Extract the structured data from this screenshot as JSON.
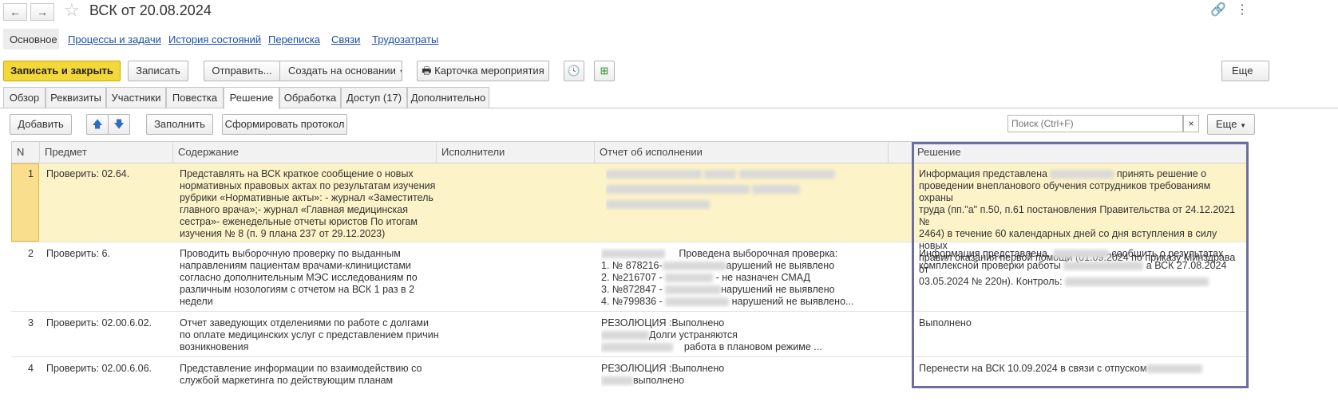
{
  "window": {
    "title": "ВСК от 20.08.2024",
    "more_glyph": "⋮"
  },
  "nav_links": [
    "Основное",
    "Процессы и задачи",
    "История состояний",
    "Переписка",
    "Связи",
    "Трудозатраты"
  ],
  "toolbar": {
    "save_close": "Записать и закрыть",
    "save": "Записать",
    "send": "Отправить...",
    "create_based": "Создать на основании",
    "event_card": "Карточка мероприятия",
    "more": "Еще"
  },
  "tabs": [
    "Обзор",
    "Реквизиты",
    "Участники",
    "Повестка",
    "Решение",
    "Обработка",
    "Доступ (17)",
    "Дополнительно"
  ],
  "grid_toolbar": {
    "add": "Добавить",
    "fill": "Заполнить",
    "protocol": "Сформировать протокол",
    "search_placeholder": "Поиск (Ctrl+F)",
    "more": "Еще"
  },
  "columns": [
    "N",
    "Предмет",
    "Содержание",
    "Исполнители",
    "Отчет об исполнении",
    "Решение"
  ],
  "rows": [
    {
      "n": "1",
      "subject": "Проверить: 02.64.",
      "content": [
        "Представлять на ВСК краткое сообщение о новых",
        "нормативных правовых актах по результатам изучения",
        "рубрики «Нормативные акты»: - журнал «Заместитель",
        "главного врача»;- журнал «Главная медицинская",
        "сестра»- еженедельные отчеты юристов По итогам",
        "изучения № 8 (п. 9 плана 237 от 29.12.2023)"
      ],
      "report": [],
      "decision": [
        "Информация представлена",
        "принять решение о",
        "проведении внепланового обучения сотрудников требованиям охраны",
        "труда (пп.\"а\" п.50, п.61 постановления Правительства от 24.12.2021 №",
        "2464) в течение 60 календарных дней со дня вступления в силу новых",
        "правил оказания первой помощи (01.09.2024 по приказу Минздрава от",
        "03.05.2024 № 220н). Контроль:"
      ]
    },
    {
      "n": "2",
      "subject": "Проверить: 6.",
      "content": [
        "Проводить выборочную проверку по выданным",
        "направлениям пациентам врачами-клиницистами",
        "согласно дополнительным МЭС исследованиям по",
        "различным нозологиям с отчетом на ВСК 1 раз в 2",
        "недели"
      ],
      "report": [
        "Проведена выборочная проверка:",
        "1. № 878216-",
        "арушений не выявлено",
        "2. №216707 -",
        "- не назначен СМАД",
        "3. №872847 -",
        "нарушений не выявлено",
        "4. №799836 -",
        "нарушений не выявлено..."
      ],
      "decision": [
        "Информация представлена.",
        "сообщить о результатах",
        "комплексной проверки работы",
        "а ВСК 27.08.2024"
      ]
    },
    {
      "n": "3",
      "subject": "Проверить: 02.00.6.02.",
      "content": [
        "Отчет заведующих отделениями по работе с долгами",
        "по оплате медицинских услуг с представлением причин",
        "возникновения"
      ],
      "report": [
        "РЕЗОЛЮЦИЯ :Выполнено",
        "Долги устраняются",
        "работа в плановом режиме ..."
      ],
      "decision": [
        "Выполнено"
      ]
    },
    {
      "n": "4",
      "subject": "Проверить: 02.00.6.06.",
      "content": [
        "Представление информации по взаимодействию со",
        "службой маркетинга по действующим планам"
      ],
      "report": [
        "РЕЗОЛЮЦИЯ :Выполнено",
        "выполнено"
      ],
      "decision": [
        "Перенести на ВСК 10.09.2024 в связи с отпуском"
      ]
    }
  ]
}
